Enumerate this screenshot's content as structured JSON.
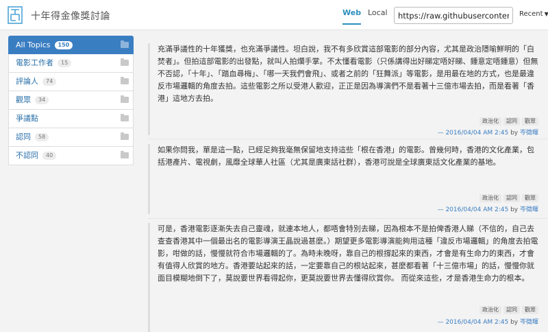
{
  "header": {
    "title": "十年得金像獎討論",
    "tabs": [
      {
        "label": "Web",
        "active": true
      },
      {
        "label": "Local",
        "active": false
      }
    ],
    "url_value": "https://raw.githubusercontent.c",
    "recent_label": "Recent"
  },
  "sidebar": {
    "items": [
      {
        "label": "All Topics",
        "count": "150",
        "active": true
      },
      {
        "label": "電影工作者",
        "count": "15"
      },
      {
        "label": "評論人",
        "count": "74"
      },
      {
        "label": "觀眾",
        "count": "34"
      },
      {
        "label": "爭議點",
        "count": ""
      },
      {
        "label": "認同",
        "count": "58"
      },
      {
        "label": "不認同",
        "count": "40"
      }
    ]
  },
  "posts": [
    {
      "text": "充滿爭議性的十年獲獎，也充滿爭議性。坦白說，我不有多欣賞這部電影的部分內容，尤其是政治隱喻鮮明的「白焚者」。但拍這部電影的出發點，就叫人拍爛手掌。不太懂看電影（只係講得出好睇定唔好睇、鍾意定唔鍾意）但無不否認，「十年」、「踏血尋梅」、「哪一天我們會飛」、或者之前的「狂舞派」等電影，是用最在地的方式，也是最違反市場邏輯的角度去拍。這些電影之所以受港人歡迎，正正是因為導演們不是看著十三億市場去拍，而是看著「香港」這地方去拍。",
      "tags": [
        "政治化",
        "認同",
        "觀眾"
      ],
      "date": "— 2016/04/04 AM 2:45",
      "by": "by",
      "author": "岑徵暉"
    },
    {
      "text": "如果你問我，單是這一點，已經足夠我毫無保留地支持這些「根在香港」的電影。曾幾何時，香港的文化產業，包括港產片、電視劇，風靡全球華人社區（尤其是廣東話社群），香港可說是全球廣東話文化產業的基地。",
      "tags": [
        "政治化",
        "認同",
        "觀眾"
      ],
      "date": "— 2016/04/04 AM 2:45",
      "by": "by",
      "author": "岑徵暉"
    },
    {
      "text": "可是，香港電影逐漸失去自己靈魂，就連本地人，都唔會特別去睇，因為根本不是拍俾香港人睇（不信的，自己去查查香港其中一個最出名的電影導演王晶說過甚麼。）期望更多電影導演能夠用這種「違反市場邏輯」的角度去拍電影，咁做的話，慢慢就符合市場邏輯的了。為時未晚呀，靠自己的根撐起來的東西，才會是有生命力的東西，才會有值得人欣賞的地方。香港要站起來的話，一定要靠自己的根站起來，甚麼都看著「十三億市場」的話，慢慢你就面目模糊地倒下了，莫說要世界看得起你，更莫說要世界去懂得欣賞你。 而從來這些，才是香港生命力的根本。",
      "tags": [
        "政治化",
        "認同",
        "觀眾"
      ],
      "date": "— 2016/04/04 AM 2:45",
      "by": "by",
      "author": "岑徵暉"
    }
  ]
}
